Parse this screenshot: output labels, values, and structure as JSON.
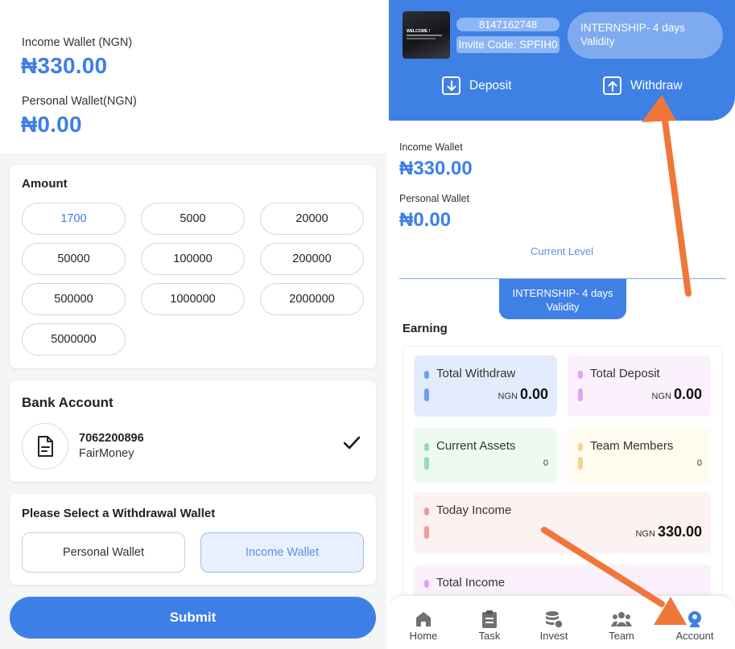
{
  "left": {
    "income_wallet_label": "Income Wallet (NGN)",
    "income_wallet_amount": "₦330.00",
    "personal_wallet_label": "Personal Wallet(NGN)",
    "personal_wallet_amount": "₦0.00",
    "amount_title": "Amount",
    "amounts": [
      "1700",
      "5000",
      "20000",
      "50000",
      "100000",
      "200000",
      "500000",
      "1000000",
      "2000000",
      "5000000"
    ],
    "selected_amount": "1700",
    "bank_title": "Bank Account",
    "bank_number": "7062200896",
    "bank_name": "FairMoney",
    "select_wallet_title": "Please Select a Withdrawal Wallet",
    "wallet_options": [
      "Personal Wallet",
      "Income Wallet"
    ],
    "selected_wallet": "Income Wallet",
    "submit_label": "Submit"
  },
  "right": {
    "avatar_text": "WELCOME !",
    "phone": "8147162748",
    "invite_code": "Invite Code: SPFIH0",
    "internship_line1": "INTERNSHIP- 4 days",
    "internship_line2": "Validity",
    "deposit_label": "Deposit",
    "withdraw_label": "Withdraw",
    "income_wallet_label": "Income Wallet",
    "income_wallet_amount": "₦330.00",
    "personal_wallet_label": "Personal Wallet",
    "personal_wallet_amount": "₦0.00",
    "current_level_label": "Current Level",
    "level_line1": "INTERNSHIP- 4 days",
    "level_line2": "Validity",
    "earning_title": "Earning",
    "stats": {
      "total_withdraw": {
        "label": "Total Withdraw",
        "currency": "NGN",
        "value": "0.00",
        "color": "#6f9ff0"
      },
      "total_deposit": {
        "label": "Total Deposit",
        "currency": "NGN",
        "value": "0.00",
        "color": "#e0a4f0"
      },
      "current_assets": {
        "label": "Current Assets",
        "value": "0",
        "color": "#9adbb0"
      },
      "team_members": {
        "label": "Team Members",
        "value": "0",
        "color": "#f3d68a"
      },
      "today_income": {
        "label": "Today Income",
        "currency": "NGN",
        "value": "330.00",
        "color": "#f09a9a"
      },
      "total_income": {
        "label": "Total Income",
        "color": "#e0a4f0"
      }
    },
    "nav": [
      {
        "label": "Home",
        "icon": "home-icon"
      },
      {
        "label": "Task",
        "icon": "task-icon"
      },
      {
        "label": "Invest",
        "icon": "invest-icon"
      },
      {
        "label": "Team",
        "icon": "team-icon"
      },
      {
        "label": "Account",
        "icon": "account-icon",
        "active": true
      }
    ]
  },
  "colors": {
    "accent": "#3d7fe6",
    "banner": "#3f80e4",
    "annotation_arrow": "#f0763a"
  }
}
